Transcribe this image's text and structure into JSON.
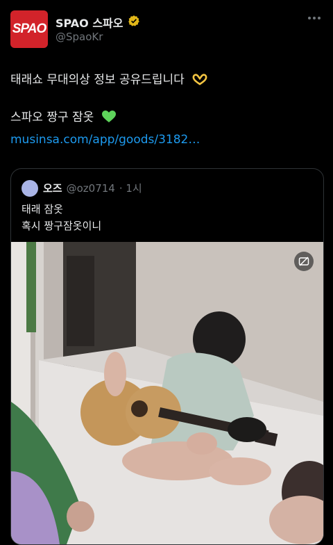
{
  "author": {
    "logo_text": "SPAO",
    "display_name": "SPAO 스파오",
    "handle": "@SpaoKr"
  },
  "tweet": {
    "line1": "태래쇼 무대의상 정보 공유드립니다",
    "line2": "스파오 짱구 잠옷",
    "link": "musinsa.com/app/goods/3182…"
  },
  "quoted": {
    "name": "오즈",
    "handle": "@oz0714",
    "time": "· 1시",
    "line1": "태래 잠옷",
    "line2": "혹시 짱구잠옷이니"
  },
  "colors": {
    "background": "#000000",
    "text": "#e7e9ea",
    "muted": "#71767b",
    "link": "#1d9bf0",
    "brand": "#d2232a",
    "verified": "#e2b719"
  },
  "icons": {
    "verified": "verified-badge-icon",
    "more": "more-icon",
    "hands": "heart-hands-emoji-icon",
    "heart": "green-heart-emoji-icon",
    "gif": "gif-play-icon"
  }
}
